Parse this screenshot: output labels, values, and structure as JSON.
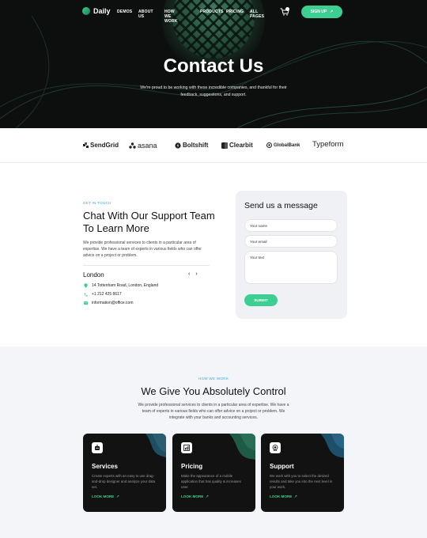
{
  "brand": {
    "name": "Daily"
  },
  "nav": {
    "items": [
      {
        "label": "DEMOS"
      },
      {
        "label": "ABOUT US"
      },
      {
        "label": "HOW WE WORK"
      },
      {
        "label": "PRODUCTS"
      },
      {
        "label": "PRICING"
      },
      {
        "label": "ALL PAGES"
      }
    ],
    "signup_label": "SIGN UP",
    "signup_arrow": "↗",
    "cart_icon": "cart-icon"
  },
  "hero": {
    "title": "Contact Us",
    "subtitle": "We're proud to be working with these incredible companies, and thankful for their feedback, suggestions, and support."
  },
  "logos": {
    "items": [
      {
        "name": "SendGrid"
      },
      {
        "name": "asana"
      },
      {
        "name": "Boltshift"
      },
      {
        "name": "Clearbit"
      },
      {
        "name": "GlobalBank"
      },
      {
        "name": "Typeform"
      }
    ]
  },
  "contact": {
    "eyebrow": "GET IN TOUCH",
    "title": "Chat With Our Support Team To Learn More",
    "text": "We provide professional services to clients in a particular area of expertise.  We have a team of experts in various fields who can offer advice on a project or problem.",
    "city": "London",
    "prev_arrow": "‹",
    "next_arrow": "›",
    "address": "14 Tottenham Road, London, England",
    "phone": "+1 212 425 8617",
    "email": "information@office.com"
  },
  "form": {
    "title": "Send us a message",
    "name_placeholder": "Your name",
    "email_placeholder": "Your email",
    "text_placeholder": "Your text",
    "submit_label": "SUBMIT"
  },
  "work": {
    "eyebrow": "HOW WE WORK",
    "title": "We Give You Absolutely Control",
    "text": "We provide professional services to clients in a particular area of expertise.  We have a team of experts in various fields who can offer advice on a project or problem. We integrate with your banks and accounting services.",
    "cards": [
      {
        "title": "Services",
        "text": "Create experts with an easy to use drag-and-drop designer and analyze your data set.",
        "link": "LOOK MORE",
        "link_arrow": "↗",
        "icon": "robot-icon"
      },
      {
        "title": "Pricing",
        "text": "Make the appearance of a mobile application that has quality & increases user.",
        "link": "LOOK MORE",
        "link_arrow": "↗",
        "icon": "chart-icon"
      },
      {
        "title": "Support",
        "text": "We work with you to select the desired results and take you into the next level in your work.",
        "link": "LOOK MORE",
        "link_arrow": "↗",
        "icon": "badge-icon"
      }
    ]
  },
  "colors": {
    "accent": "#3ccf91",
    "eyebrow": "#3ca6e0",
    "dark": "#0d0f0e"
  }
}
